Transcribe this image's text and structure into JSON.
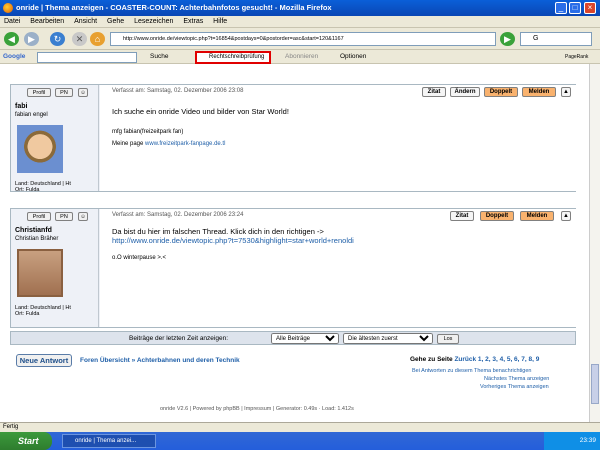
{
  "window": {
    "title": "onride | Thema anzeigen - COASTER-COUNT: Achterbahnfotos gesucht! - Mozilla Firefox"
  },
  "menu": [
    "Datei",
    "Bearbeiten",
    "Ansicht",
    "Gehe",
    "Lesezeichen",
    "Extras",
    "Hilfe"
  ],
  "address": {
    "url": "http://www.onride.de/viewtopic.php?t=16854&postdays=0&postorder=asc&start=120&1167"
  },
  "search": {
    "value": "G"
  },
  "google_toolbar": {
    "label": "Google",
    "search_label": "Suche",
    "spellcheck_label": "Rechtschreibprüfung",
    "subscribe_label": "Abonnieren",
    "options_label": "Optionen",
    "pagerank": "PageRank"
  },
  "posts": [
    {
      "author": "fabi",
      "realname": "fabian engel",
      "profile": "Profil",
      "pm": "PN",
      "location": "Land: Deutschland | Ht",
      "ort": "Ort: Fulda",
      "date": "Verfasst am: Samstag, 02. Dezember 2006 23:08",
      "actions": [
        "Zitat",
        "Ändern",
        "Doppelt",
        "Melden"
      ],
      "line1": "Ich suche ein onride Video und bilder von Star World!",
      "line2": "mfg fabian(freizeitpark fan)",
      "homepage_label": "Meine page",
      "homepage_link": "www.freizeitpark-fanpage.de.tl"
    },
    {
      "author": "Christianfd",
      "realname": "Christian Bräher",
      "profile": "Profil",
      "pm": "PN",
      "location": "Land: Deutschland | Ht",
      "ort": "Ort: Fulda",
      "date": "Verfasst am: Samstag, 02. Dezember 2006 23:24",
      "actions": [
        "Zitat",
        "Doppelt",
        "Melden"
      ],
      "line1": "Da bist du hier im falschen Thread. Klick dich in den richtigen ->",
      "link": "http://www.onride.de/viewtopic.php?t=7530&highlight=star+world+renoldi",
      "line2": "o.O winterpause >.<"
    }
  ],
  "filter": {
    "label": "Beiträge der letzten Zeit anzeigen:",
    "opt1": "Alle Beiträge",
    "opt2": "Die ältesten zuerst",
    "go": "Los"
  },
  "footer_nav": {
    "new_reply": "Neue Antwort",
    "breadcrumb": "Foren Übersicht » Achterbahnen und deren Technik",
    "goto_label": "Gehe zu Seite",
    "prev": "Zurück",
    "pages": "1, 2, 3, 4, 5, 6, 7, 8, 9",
    "notify": "Bei Antworten zu diesem Thema benachrichtigen",
    "next_topic": "Nächstes Thema anzeigen",
    "prev_topic": "Vorheriges Thema anzeigen"
  },
  "credits": "onride V2.6 | Powered by phpBB | Impressum | Generator: 0.49s · Load: 1.412s",
  "status": "Fertig",
  "taskbar": {
    "start": "Start",
    "item": "onride | Thema anzei...",
    "clock": "23:39"
  }
}
